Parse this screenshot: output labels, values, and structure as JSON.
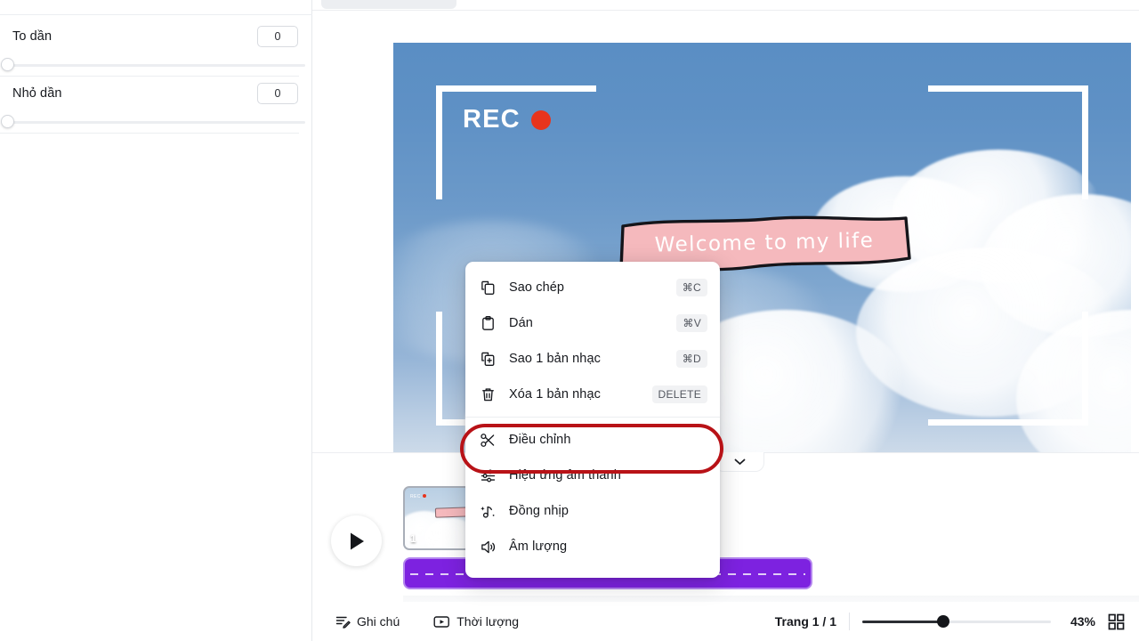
{
  "left_panel": {
    "properties": [
      {
        "label": "To dần",
        "value": "0",
        "slider_percent": 0
      },
      {
        "label": "Nhỏ dần",
        "value": "0",
        "slider_percent": 0
      }
    ]
  },
  "canvas": {
    "rec_label": "REC",
    "rec_dot_color": "#e8341c",
    "banner_text": "Welcome to my life",
    "banner_color": "#f5b9bd",
    "sky_color": "#6b99c9"
  },
  "timeline": {
    "play_icon": "play-icon",
    "clip_number": "1",
    "audio_track_color": "#7d22e0",
    "collapse_icon": "chevron-down-icon"
  },
  "context_menu": {
    "items": [
      {
        "label": "Sao chép",
        "shortcut": "⌘C",
        "icon": "copy-icon"
      },
      {
        "label": "Dán",
        "shortcut": "⌘V",
        "icon": "paste-icon"
      },
      {
        "label": "Sao 1 bản nhạc",
        "shortcut": "⌘D",
        "icon": "duplicate-icon"
      },
      {
        "label": "Xóa 1 bản nhạc",
        "shortcut": "DELETE",
        "icon": "trash-icon"
      },
      {
        "label": "Điều chỉnh",
        "shortcut": "",
        "icon": "scissors-icon"
      },
      {
        "label": "Hiệu ứng âm thanh",
        "shortcut": "",
        "icon": "equalizer-icon"
      },
      {
        "label": "Đồng nhịp",
        "shortcut": "",
        "icon": "beat-sync-icon"
      },
      {
        "label": "Âm lượng",
        "shortcut": "",
        "icon": "volume-icon"
      }
    ],
    "highlight_color": "#b81217",
    "highlighted_item": "Điều chỉnh"
  },
  "bottom_bar": {
    "notes_label": "Ghi chú",
    "duration_label": "Thời lượng",
    "page_indicator": "Trang 1 / 1",
    "zoom_percent": "43%",
    "zoom_value": 43,
    "grid_icon": "grid-view-icon"
  }
}
